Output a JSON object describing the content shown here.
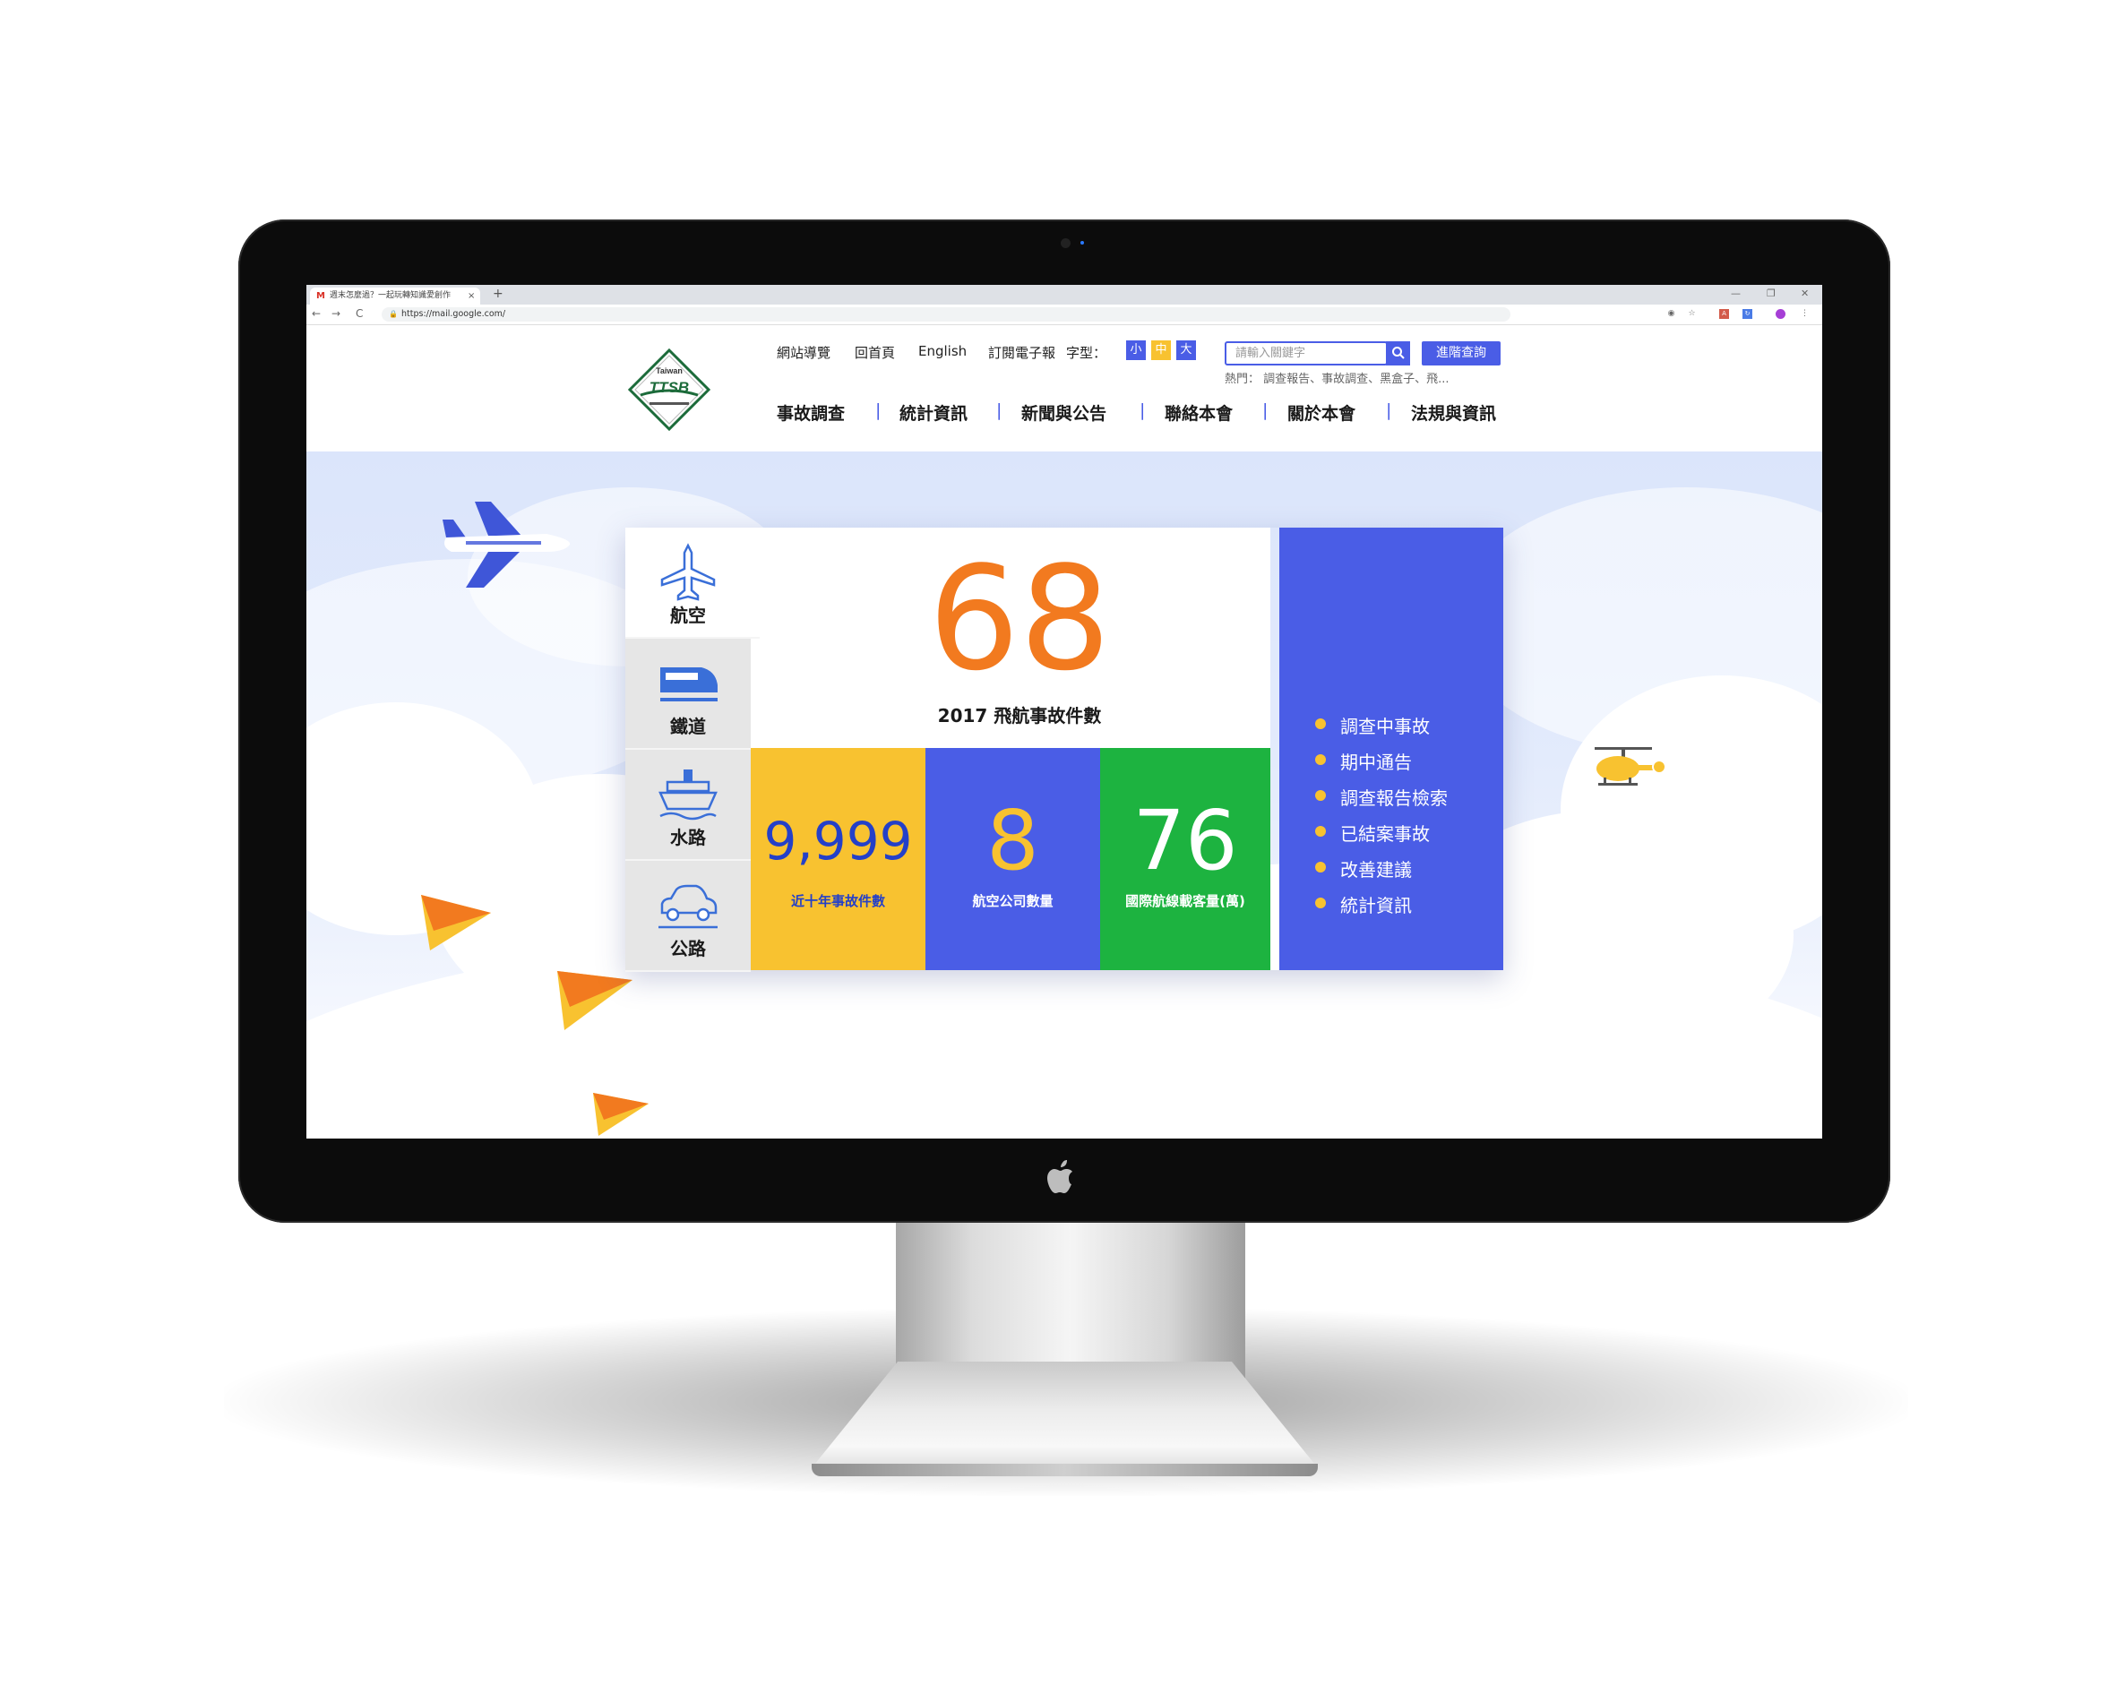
{
  "browser": {
    "tab_title": "週末怎麼過？一起玩轉知識愛創作",
    "tab_close": "×",
    "new_tab": "+",
    "url": "https://mail.google.com/",
    "window_controls": [
      "—",
      "❐",
      "✕"
    ],
    "nav": [
      "←",
      "→",
      "C"
    ]
  },
  "site": {
    "logo_text": "Taiwan",
    "logo_mark": "TTSB",
    "top_links": [
      "網站導覽",
      "回首頁",
      "English",
      "訂閱電子報",
      "字型："
    ],
    "font_sizes": [
      "小",
      "中",
      "大"
    ],
    "font_size_colors": [
      "#4a5de6",
      "#f8c230",
      "#4a5de6"
    ],
    "search_placeholder": "請輸入關鍵字",
    "advanced_search": "進階查詢",
    "hot_searches": "熱門： 調查報告、事故調查、黑盒子、飛...",
    "main_nav": [
      "事故調查",
      "統計資訊",
      "新聞與公告",
      "聯絡本會",
      "關於本會",
      "法規與資訊"
    ],
    "nav_separator": "|"
  },
  "panel": {
    "tabs": [
      "航空",
      "鐵道",
      "水路",
      "公路"
    ],
    "active_tab": "航空",
    "headline_value": "68",
    "headline_label": "2017 飛航事故件數",
    "stats": [
      {
        "value": "9,999",
        "label": "近十年事故件數",
        "bg": "#f8c230",
        "color": "#2440c8"
      },
      {
        "value": "8",
        "label": "航空公司數量",
        "bg": "#4a5de6",
        "color": "#f8c230"
      },
      {
        "value": "76",
        "label": "國際航線載客量(萬)",
        "bg": "#1db340",
        "color": "#ffffff"
      }
    ],
    "menu": [
      "調查中事故",
      "期中通告",
      "調查報告檢索",
      "已結案事故",
      "改善建議",
      "統計資訊"
    ]
  },
  "colors": {
    "accent": "#4a5de6",
    "orange": "#f27a1f",
    "yellow": "#f8c230",
    "green": "#1db340"
  },
  "icons": [
    "airplane-icon",
    "train-icon",
    "ship-icon",
    "car-icon",
    "search-icon",
    "apple-logo-icon",
    "helicopter-icon",
    "kite-icon"
  ]
}
